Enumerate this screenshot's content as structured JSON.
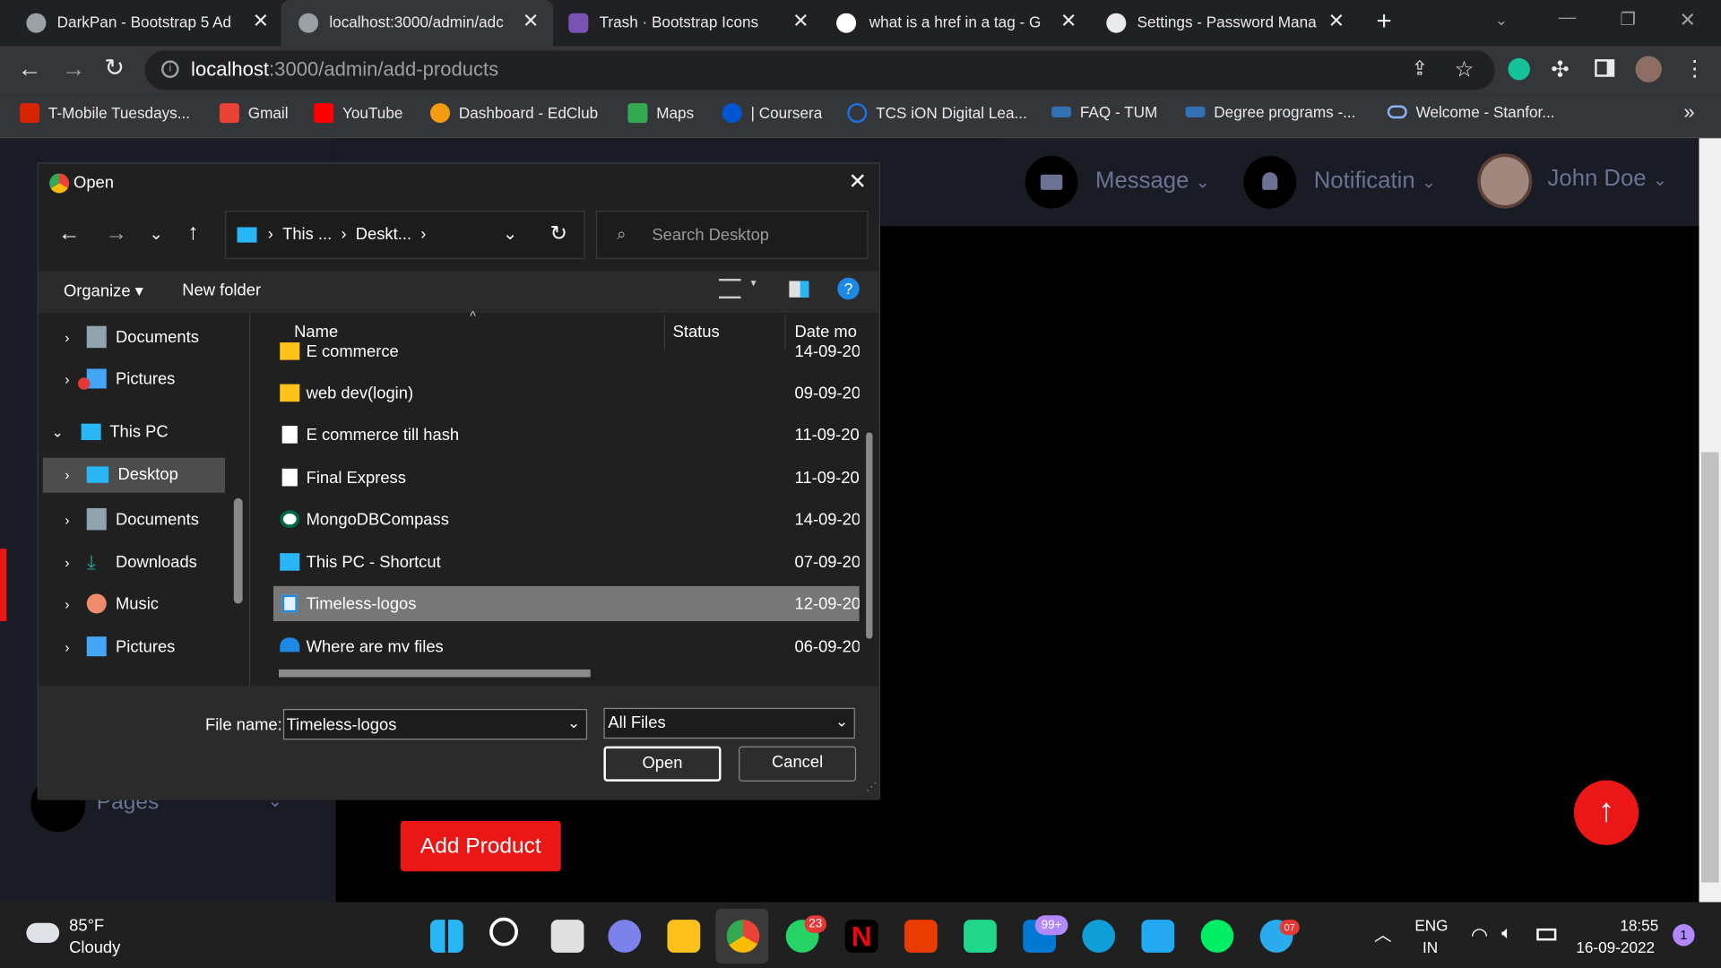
{
  "browser": {
    "tabs": [
      {
        "title": "DarkPan - Bootstrap 5 Ad"
      },
      {
        "title": "localhost:3000/admin/adc"
      },
      {
        "title": "Trash · Bootstrap Icons"
      },
      {
        "title": "what is a href in a tag - G"
      },
      {
        "title": "Settings - Password Mana"
      }
    ],
    "url_host": "localhost",
    "url_path": ":3000/admin/add-products",
    "bookmarks": [
      "T-Mobile Tuesdays...",
      "Gmail",
      "YouTube",
      "Dashboard - EdClub",
      "Maps",
      "| Coursera",
      "TCS iON Digital Lea...",
      "FAQ - TUM",
      "Degree programs -...",
      "Welcome - Stanfor..."
    ],
    "bookmarks_overflow": "»"
  },
  "app": {
    "nav": {
      "message": "Message",
      "notification": "Notificatin",
      "user": "John Doe"
    },
    "sidebar_pages": "Pages",
    "add_product": "Add Product",
    "accent": "#eb1616"
  },
  "dialog": {
    "title": "Open",
    "breadcrumb": [
      "This ...",
      "Deskt..."
    ],
    "search_placeholder": "Search Desktop",
    "organize": "Organize",
    "new_folder": "New folder",
    "nav_pane": [
      {
        "label": "Documents",
        "icon": "documents-icon"
      },
      {
        "label": "Pictures",
        "icon": "pictures-icon"
      },
      {
        "label": "This PC",
        "icon": "computer-icon"
      },
      {
        "label": "Desktop",
        "icon": "desktop-icon"
      },
      {
        "label": "Documents",
        "icon": "documents-icon"
      },
      {
        "label": "Downloads",
        "icon": "download-icon"
      },
      {
        "label": "Music",
        "icon": "music-icon"
      },
      {
        "label": "Pictures",
        "icon": "pictures-icon"
      }
    ],
    "columns": {
      "name": "Name",
      "status": "Status",
      "date": "Date mo"
    },
    "files": [
      {
        "name": "E commerce",
        "date": "14-09-20",
        "icon": "folder-icon"
      },
      {
        "name": "web dev(login)",
        "date": "09-09-20",
        "icon": "folder-icon"
      },
      {
        "name": "E commerce till hash",
        "date": "11-09-20",
        "icon": "file-icon"
      },
      {
        "name": "Final Express",
        "date": "11-09-20",
        "icon": "file-icon"
      },
      {
        "name": "MongoDBCompass",
        "date": "14-09-20",
        "icon": "app-shortcut-icon"
      },
      {
        "name": "This PC - Shortcut",
        "date": "07-09-20",
        "icon": "shortcut-icon"
      },
      {
        "name": "Timeless-logos",
        "date": "12-09-20",
        "icon": "image-icon",
        "selected": true
      },
      {
        "name": "Where are my files",
        "date": "06-09-20",
        "icon": "onedrive-shortcut-icon"
      }
    ],
    "filename_label": "File name:",
    "filename_value": "Timeless-logos",
    "filetype": "All Files",
    "open_button": "Open",
    "cancel_button": "Cancel"
  },
  "taskbar": {
    "weather_temp": "85°F",
    "weather_desc": "Cloudy",
    "whatsapp_badge": "23",
    "mail_badge": "99+",
    "telegram_badge": "07",
    "language": "ENG",
    "region": "IN",
    "time": "18:55",
    "date": "16-09-2022",
    "notification_count": "1"
  }
}
